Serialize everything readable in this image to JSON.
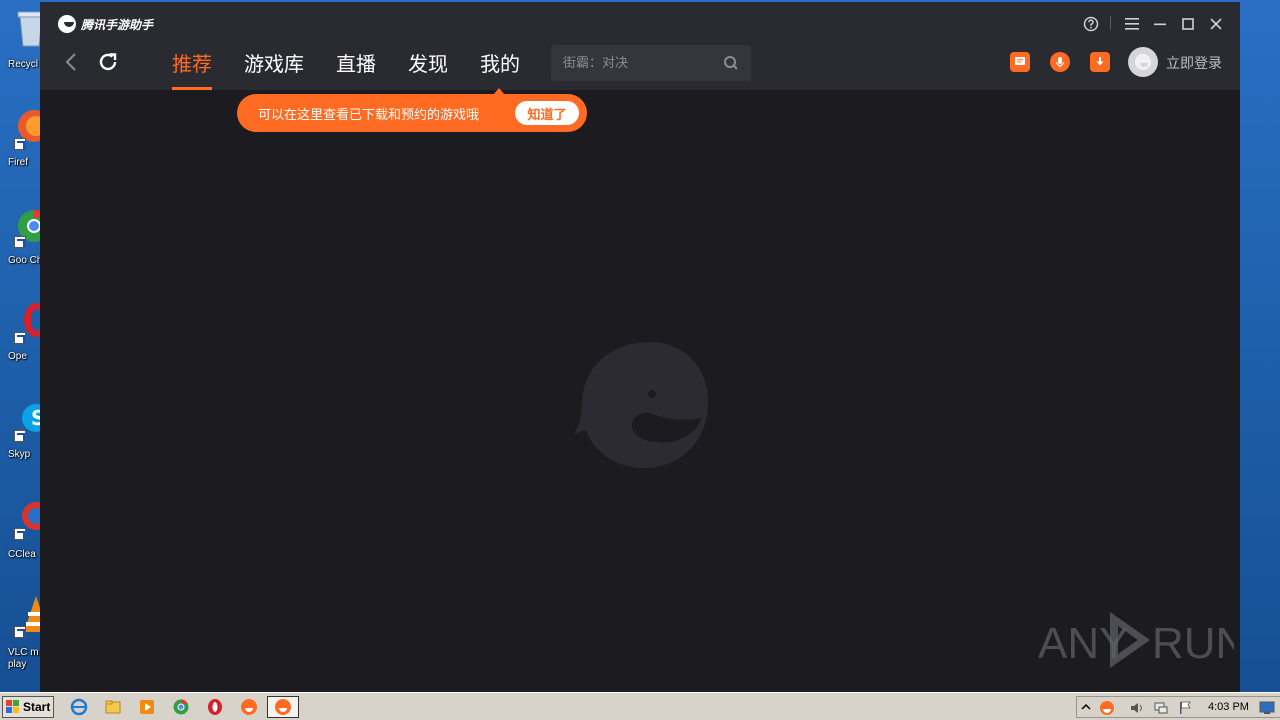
{
  "desktop": {
    "icons": [
      {
        "label": "Recycl"
      },
      {
        "label": "Firef"
      },
      {
        "label": "Goo Chro"
      },
      {
        "label": "Ope"
      },
      {
        "label": "Skyp"
      },
      {
        "label": "CClea"
      },
      {
        "label": "VLC m play"
      }
    ]
  },
  "app": {
    "title": "腾讯手游助手",
    "tabs": [
      {
        "label": "推荐",
        "active": true
      },
      {
        "label": "游戏库",
        "active": false
      },
      {
        "label": "直播",
        "active": false
      },
      {
        "label": "发现",
        "active": false
      },
      {
        "label": "我的",
        "active": false
      }
    ],
    "search": {
      "placeholder": "街霸：对决"
    },
    "login_label": "立即登录",
    "tooltip": {
      "text": "可以在这里查看已下载和预约的游戏哦",
      "button": "知道了"
    },
    "accent": "#ff6b22",
    "background": "#1b1b20",
    "icons": {
      "back": "chevron-left-icon",
      "refresh": "refresh-icon",
      "help": "help-icon",
      "menu": "menu-icon",
      "minimize": "minimize-icon",
      "maximize": "maximize-icon",
      "close": "close-icon",
      "message": "message-icon",
      "mic": "microphone-icon",
      "download": "download-icon",
      "loading_logo": "app-logo-icon"
    }
  },
  "watermark": {
    "text_left": "ANY",
    "text_right": "RUN"
  },
  "taskbar": {
    "start_label": "Start",
    "clock": "4:03 PM"
  }
}
